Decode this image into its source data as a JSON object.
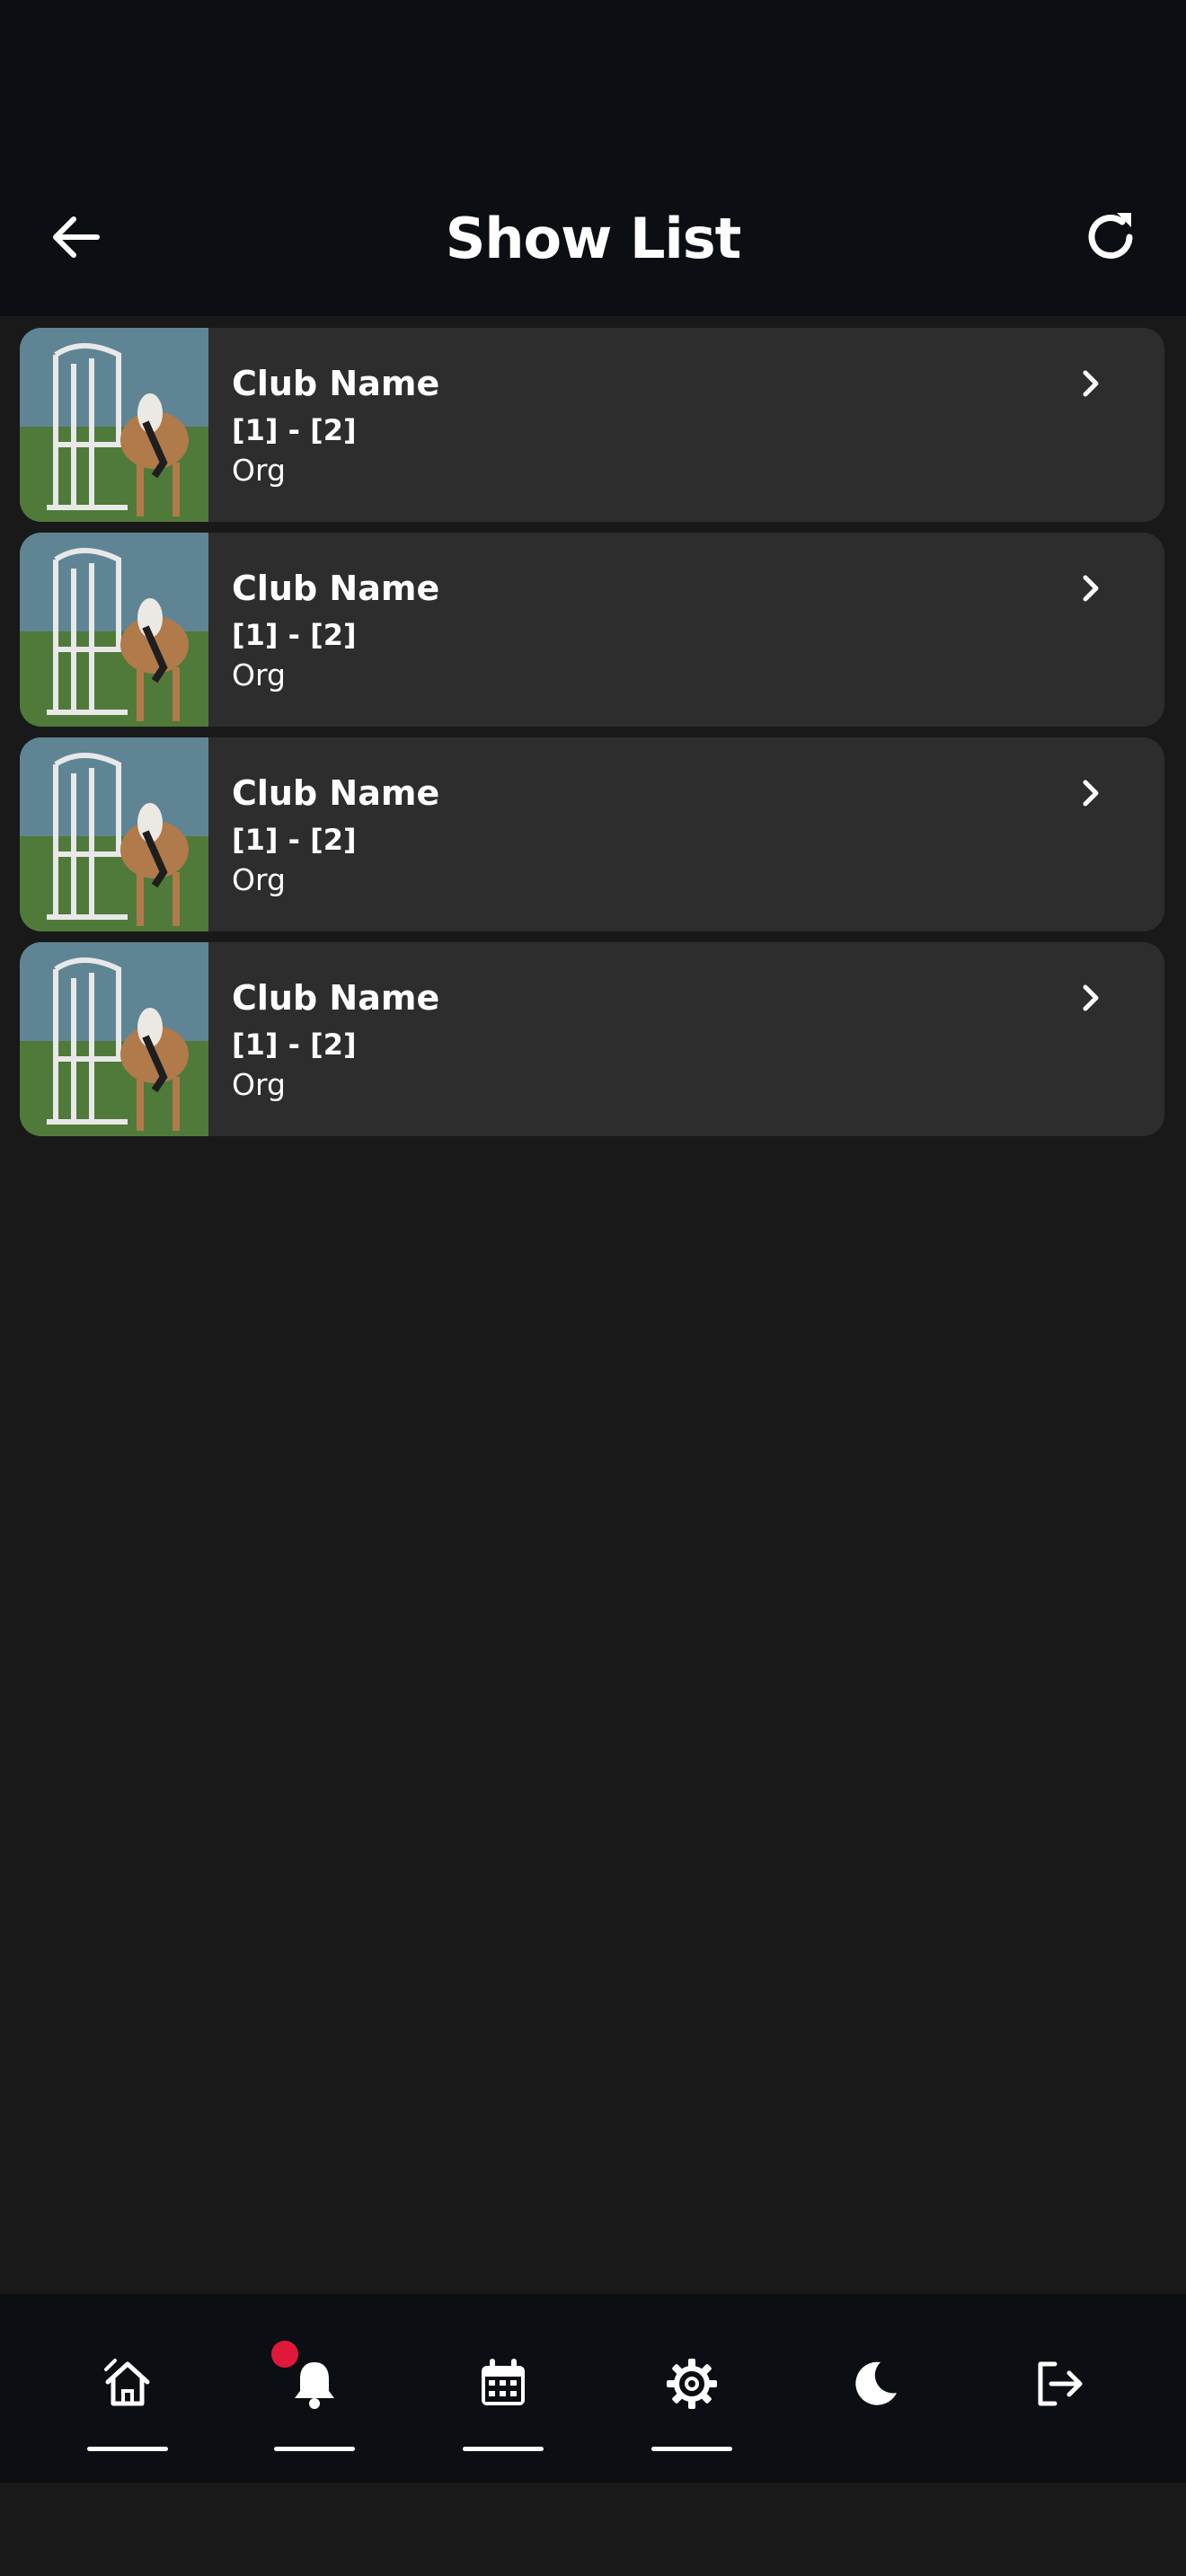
{
  "header": {
    "title": "Show List",
    "back_icon": "arrow-left-icon",
    "refresh_icon": "refresh-icon"
  },
  "shows": [
    {
      "club": "Club Name",
      "range": "[1] - [2]",
      "org": "Org"
    },
    {
      "club": "Club Name",
      "range": "[1] - [2]",
      "org": "Org"
    },
    {
      "club": "Club Name",
      "range": "[1] - [2]",
      "org": "Org"
    },
    {
      "club": "Club Name",
      "range": "[1] - [2]",
      "org": "Org"
    }
  ],
  "nav": {
    "items": [
      {
        "icon": "home-icon",
        "underline": true
      },
      {
        "icon": "bell-icon",
        "underline": true,
        "badge": true
      },
      {
        "icon": "calendar-icon",
        "underline": true
      },
      {
        "icon": "gear-icon",
        "underline": true
      },
      {
        "icon": "moon-icon",
        "underline": false
      },
      {
        "icon": "logout-icon",
        "underline": false
      }
    ]
  },
  "colors": {
    "background": "#191919",
    "header": "#0b0e12",
    "card": "#2d2d2d",
    "badge": "#e0193a",
    "text": "#ffffff"
  }
}
